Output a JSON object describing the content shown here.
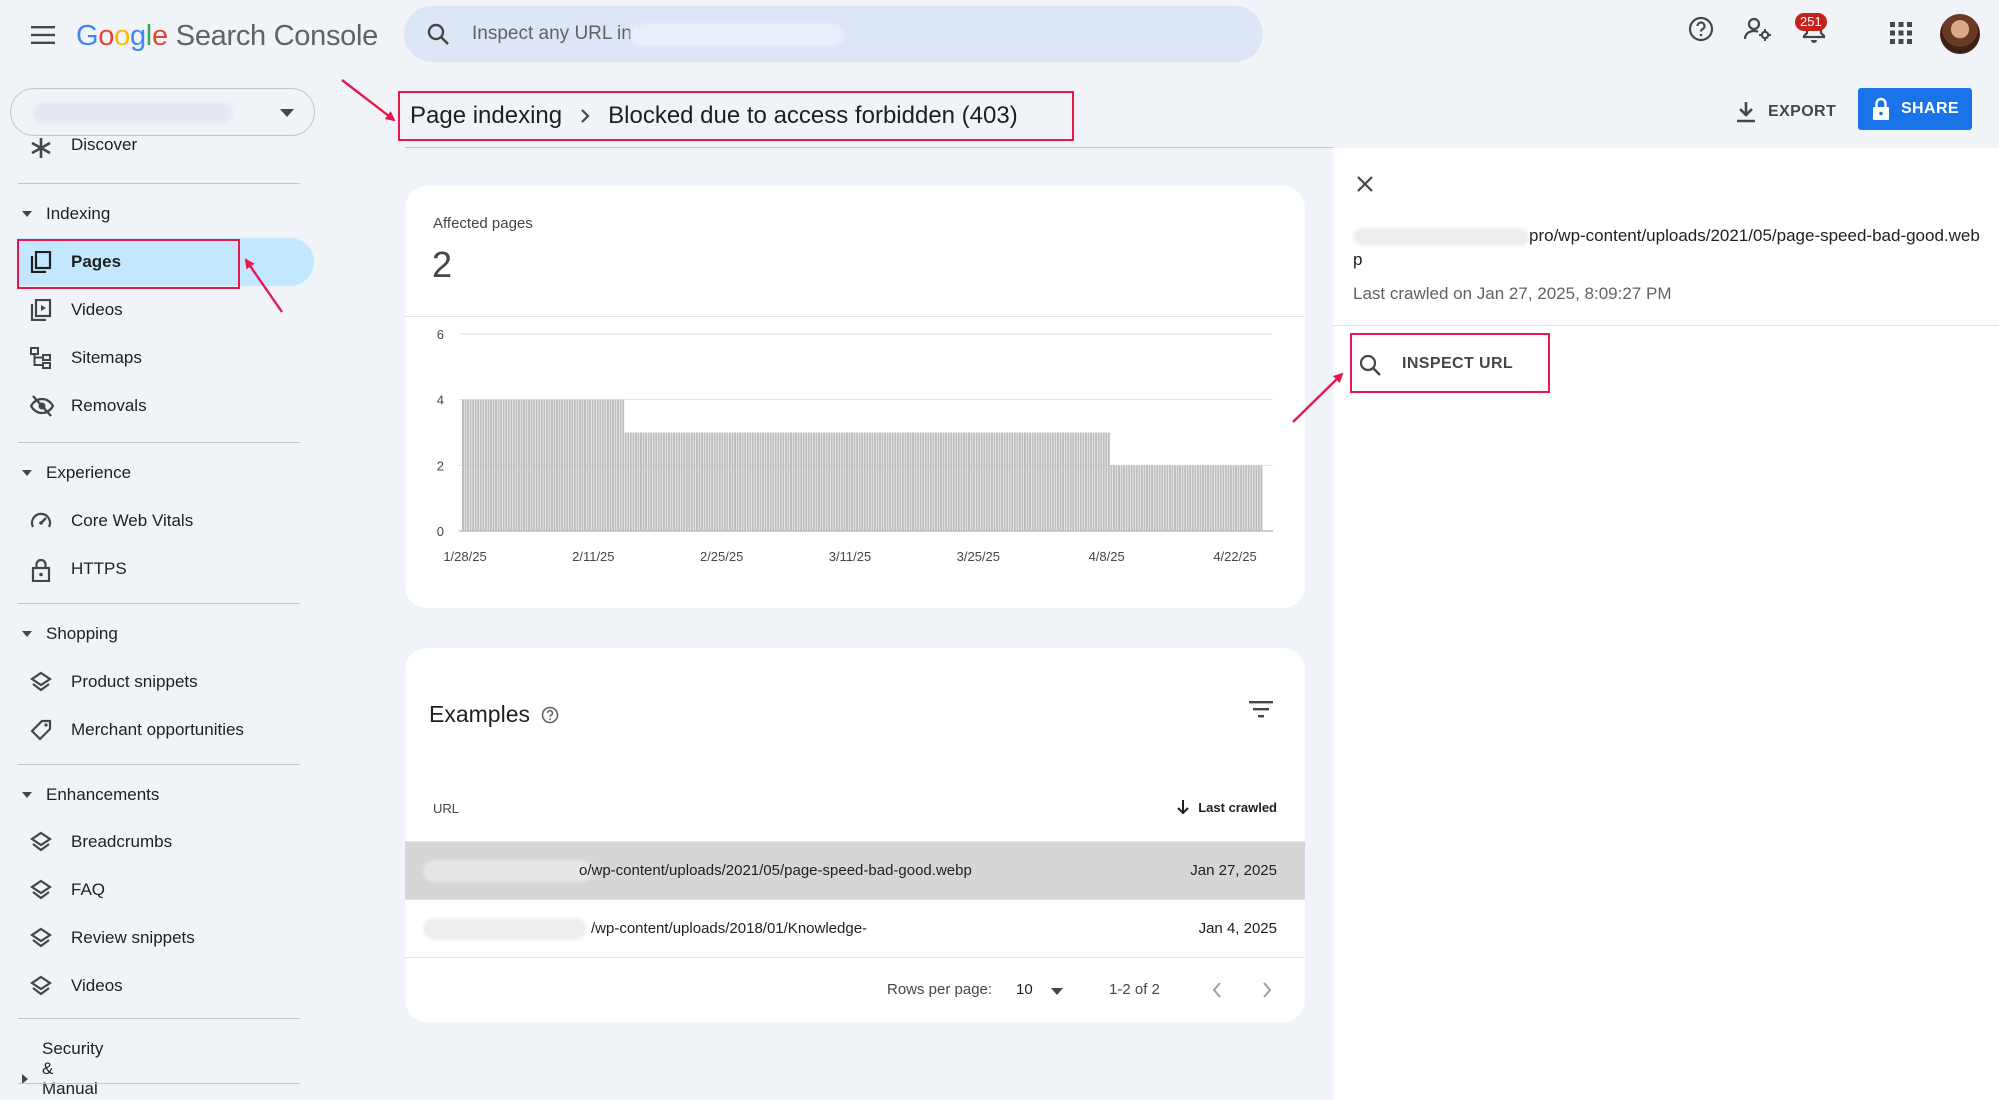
{
  "app": {
    "logo_letters": [
      "G",
      "o",
      "o",
      "g",
      "l",
      "e"
    ],
    "logo_rest": "Search Console"
  },
  "search": {
    "placeholder": "Inspect any URL in \"h",
    "placeholder_suffix": "\""
  },
  "notifications": {
    "count": "251"
  },
  "sidebar": {
    "partial_item": "Discover",
    "sections": {
      "indexing": "Indexing",
      "experience": "Experience",
      "shopping": "Shopping",
      "enhancements": "Enhancements",
      "security": "Security & Manual Actions"
    },
    "items": {
      "pages": "Pages",
      "videos": "Videos",
      "sitemaps": "Sitemaps",
      "removals": "Removals",
      "core_web_vitals": "Core Web Vitals",
      "https": "HTTPS",
      "product_snippets": "Product snippets",
      "merchant_opportunities": "Merchant opportunities",
      "breadcrumbs": "Breadcrumbs",
      "faq": "FAQ",
      "review_snippets": "Review snippets",
      "videos_enh": "Videos"
    }
  },
  "header": {
    "crumb_parent": "Page indexing",
    "crumb_current": "Blocked due to access forbidden (403)",
    "export_label": "EXPORT",
    "share_label": "SHARE"
  },
  "summary": {
    "affected_label": "Affected pages",
    "affected_value": "2"
  },
  "chart_data": {
    "type": "bar",
    "y_ticks": [
      "0",
      "2",
      "4",
      "6"
    ],
    "ylim": [
      0,
      6
    ],
    "x_tick_labels": [
      "1/28/25",
      "2/11/25",
      "2/25/25",
      "3/11/25",
      "3/25/25",
      "4/8/25",
      "4/22/25"
    ],
    "values": [
      4,
      4,
      4,
      4,
      4,
      4,
      4,
      4,
      4,
      4,
      4,
      4,
      4,
      4,
      4,
      4,
      4,
      4,
      4,
      4,
      4,
      4,
      4,
      4,
      4,
      4,
      4,
      4,
      4,
      4,
      4,
      4,
      4,
      4,
      4,
      4,
      4,
      4,
      4,
      4,
      4,
      4,
      4,
      4,
      4,
      4,
      4,
      4,
      4,
      4,
      4,
      4,
      4,
      4,
      4,
      4,
      4,
      4,
      4,
      4,
      4,
      4,
      4,
      4,
      3,
      3,
      3,
      3,
      3,
      3,
      3,
      3,
      3,
      3,
      3,
      3,
      3,
      3,
      3,
      3,
      3,
      3,
      3,
      3,
      3,
      3,
      3,
      3,
      3,
      3,
      3,
      3,
      3,
      3,
      3,
      3,
      3,
      3,
      3,
      3,
      3,
      3,
      3,
      3,
      3,
      3,
      3,
      3,
      3,
      3,
      3,
      3,
      3,
      3,
      3,
      3,
      3,
      3,
      3,
      3,
      3,
      3,
      3,
      3,
      3,
      3,
      3,
      3,
      3,
      3,
      3,
      3,
      3,
      3,
      3,
      3,
      3,
      3,
      3,
      3,
      3,
      3,
      3,
      3,
      3,
      3,
      3,
      3,
      3,
      3,
      3,
      3,
      3,
      3,
      3,
      3,
      3,
      3,
      3,
      3,
      3,
      3,
      3,
      3,
      3,
      3,
      3,
      3,
      3,
      3,
      3,
      3,
      3,
      3,
      3,
      3,
      3,
      3,
      3,
      3,
      3,
      3,
      3,
      3,
      3,
      3,
      3,
      3,
      3,
      3,
      3,
      3,
      3,
      3,
      3,
      3,
      3,
      3,
      3,
      3,
      3,
      3,
      3,
      3,
      3,
      3,
      3,
      3,
      3,
      3,
      3,
      3,
      3,
      3,
      3,
      3,
      3,
      3,
      3,
      3,
      3,
      3,
      3,
      3,
      3,
      3,
      3,
      3,
      3,
      3,
      3,
      3,
      3,
      3,
      3,
      3,
      3,
      3,
      3,
      3,
      3,
      3,
      3,
      3,
      3,
      3,
      3,
      3,
      3,
      3,
      3,
      3,
      3,
      3,
      3,
      2,
      2,
      2,
      2,
      2,
      2,
      2,
      2,
      2,
      2,
      2,
      2,
      2,
      2,
      2,
      2,
      2,
      2,
      2,
      2,
      2,
      2,
      2,
      2,
      2,
      2,
      2,
      2,
      2,
      2,
      2,
      2,
      2,
      2,
      2,
      2,
      2,
      2,
      2,
      2,
      2,
      2,
      2,
      2,
      2,
      2,
      2,
      2,
      2,
      2,
      2,
      2,
      2,
      2,
      2,
      2,
      2,
      2,
      2,
      2
    ],
    "bar_color": "#bdbdbd",
    "grid": true
  },
  "examples": {
    "title": "Examples",
    "col_url": "URL",
    "col_crawled": "Last crawled",
    "rows": [
      {
        "url": "o/wp-content/uploads/2021/05/page-speed-bad-good.webp",
        "date": "Jan 27, 2025"
      },
      {
        "url": "/wp-content/uploads/2018/01/Knowledge-",
        "date": "Jan 4, 2025"
      }
    ],
    "rows_per_page_label": "Rows per page:",
    "rows_per_page_value": "10",
    "range": "1-2 of 2"
  },
  "panel": {
    "url_tail": "pro/wp-content/uploads/2021/05/page-speed-bad-good.webp",
    "last_crawled": "Last crawled on Jan 27, 2025, 8:09:27 PM",
    "inspect_label": "INSPECT URL"
  },
  "colors": {
    "accent_blue": "#1a73e8",
    "annotation_red": "#e8174d",
    "active_nav": "#c2e7ff"
  }
}
